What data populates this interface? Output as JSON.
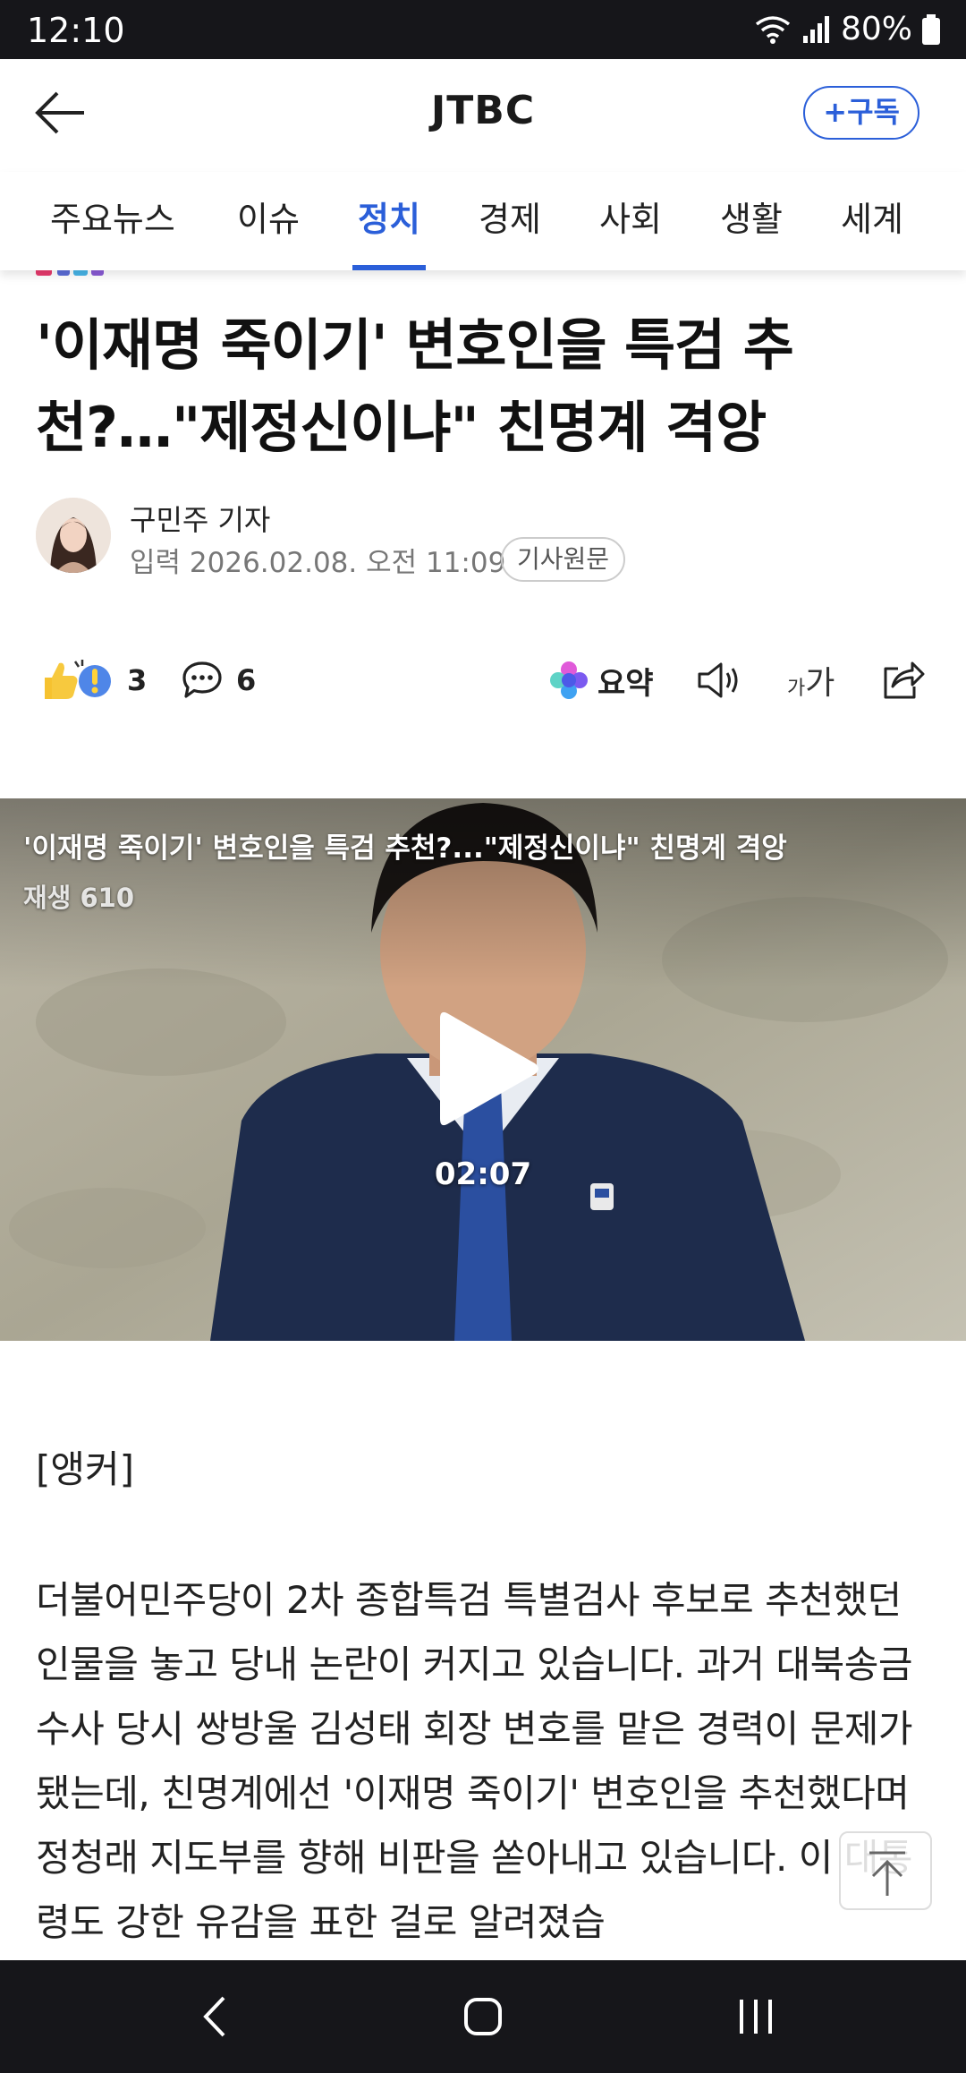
{
  "status": {
    "time": "12:10",
    "battery": "80%"
  },
  "header": {
    "back_icon": "arrow-left-icon",
    "title": "JTBC",
    "subscribe_label": "+구독"
  },
  "tabs": [
    {
      "label": "주요뉴스"
    },
    {
      "label": "이슈"
    },
    {
      "label": "정치",
      "active": true
    },
    {
      "label": "경제"
    },
    {
      "label": "사회"
    },
    {
      "label": "생활"
    },
    {
      "label": "세계"
    }
  ],
  "article": {
    "headline_line1": "'이재명 죽이기' 변호인을 특검 추",
    "headline_line2": "천?…\"제정신이냐\" 친명계 격앙",
    "reporter": "구민주 기자",
    "dateline": "입력 2026.02.08. 오전 11:09",
    "original_label": "기사원문"
  },
  "actions": {
    "reaction_count": "3",
    "comment_count": "6",
    "summary_label": "요약",
    "font_label_small": "가",
    "font_label_large": "가"
  },
  "video": {
    "title": "'이재명 죽이기' 변호인을 특검 추천?...\"제정신이냐\" 친명계 격앙",
    "views": "재생 610",
    "duration": "02:07"
  },
  "body": {
    "anchor": "[앵커]",
    "paragraph": "더불어민주당이 2차 종합특검 특별검사 후보로 추천했던 인물을 놓고 당내 논란이 커지고 있습니다. 과거 대북송금 수사 당시 쌍방울 김성태 회장 변호를 맡은 경력이 문제가 됐는데, 친명계에선 '이재명 죽이기' 변호인을 추천했다며 정청래 지도부를 향해 비판을 쏟아내고 있습니다. 이 대통령도 강한 유감을 표한 걸로 알려졌습"
  },
  "colors": {
    "accent": "#2b5fd9",
    "statusbar": "#16161a"
  }
}
